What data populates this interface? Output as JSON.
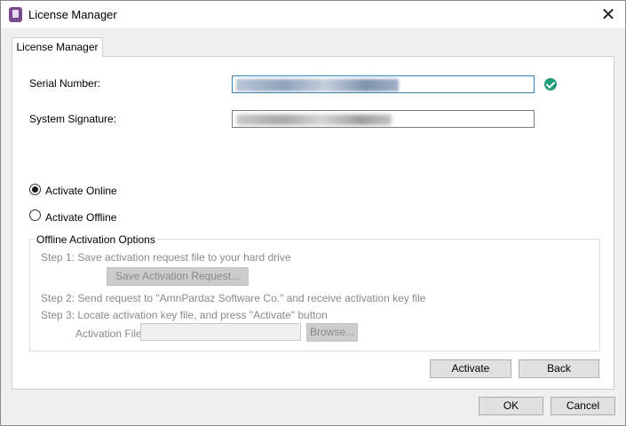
{
  "window": {
    "title": "License Manager",
    "close_glyph": "✕"
  },
  "tabs": [
    {
      "label": "License Manager"
    }
  ],
  "serial": {
    "label": "Serial Number:",
    "value": "",
    "status_icon": "check-circle-icon",
    "status_color": "#1e9b78"
  },
  "signature": {
    "label": "System Signature:",
    "value": ""
  },
  "activation_mode": {
    "options": [
      {
        "label": "Activate Online",
        "selected": true
      },
      {
        "label": "Activate Offline",
        "selected": false
      }
    ]
  },
  "offline": {
    "title": "Offline Activation Options",
    "step1": "Step 1: Save activation request file to your hard drive",
    "save_button": "Save Activation Request...",
    "step2": "Step 2: Send request to \"AmnPardaz Software Co.\" and receive activation key file",
    "step3": "Step 3: Locate activation key file, and press \"Activate\" button",
    "activation_file_label": "Activation File:",
    "activation_file_value": "",
    "browse_button": "Browse..."
  },
  "panel_buttons": {
    "activate": "Activate",
    "back": "Back"
  },
  "dialog_buttons": {
    "ok": "OK",
    "cancel": "Cancel"
  }
}
